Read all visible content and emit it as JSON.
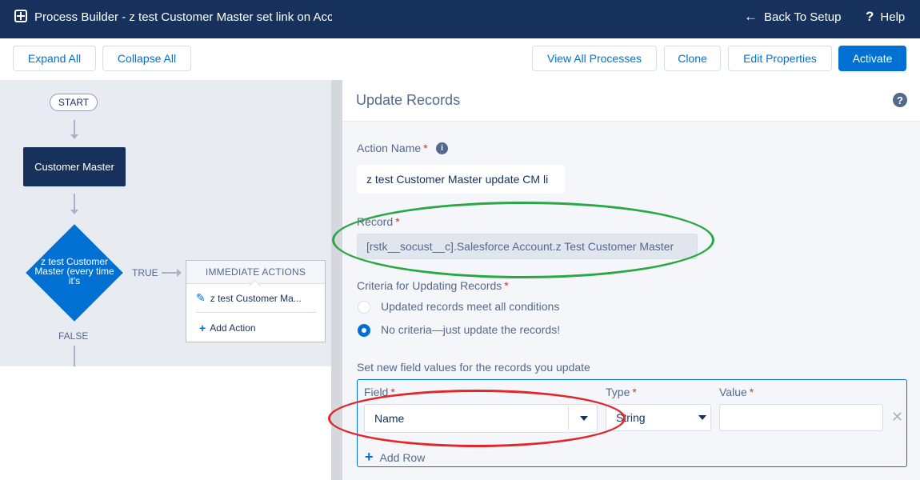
{
  "topbar": {
    "title": "Process Builder - z test Customer Master set link on Acco",
    "back_link": "Back To Setup",
    "help_link": "Help",
    "icons": {
      "app": "app-icon",
      "back": "arrow-left-icon",
      "help": "question-icon"
    }
  },
  "toolbar": {
    "expand_all": "Expand All",
    "collapse_all": "Collapse All",
    "view_all": "View All Processes",
    "clone": "Clone",
    "edit_properties": "Edit Properties",
    "activate": "Activate",
    "colors": {
      "brand": "#0070d2"
    }
  },
  "canvas": {
    "start_label": "START",
    "object_node": "Customer Master",
    "criteria_node": "z test Customer Master (every time it's",
    "true_label": "TRUE",
    "false_label": "FALSE",
    "actions_header": "IMMEDIATE ACTIONS",
    "action_item": "z test Customer Ma...",
    "add_action": "Add Action",
    "icons": {
      "action": "pencil-icon",
      "add": "plus-icon"
    }
  },
  "panel": {
    "title": "Update Records",
    "action_name_label": "Action Name",
    "action_name_value": "z test Customer Master update CM li",
    "record_label": "Record",
    "record_value": "[rstk__socust__c].Salesforce Account.z Test Customer Master",
    "criteria_label": "Criteria for Updating Records",
    "criteria_options": [
      {
        "label": "Updated records meet all conditions",
        "selected": false
      },
      {
        "label": "No criteria—just update the records!",
        "selected": true
      }
    ],
    "fields_label": "Set new field values for the records you update",
    "field_col": "Field",
    "type_col": "Type",
    "value_col": "Value",
    "row": {
      "field": "Name",
      "type": "String",
      "value": ""
    },
    "add_row": "Add Row",
    "required_mark": "*",
    "icons": {
      "info": "info-icon",
      "help": "question-circle-icon",
      "remove": "close-icon",
      "add": "plus-icon"
    }
  },
  "annotations": {
    "green": "#2aa745",
    "red": "#e0282a"
  }
}
